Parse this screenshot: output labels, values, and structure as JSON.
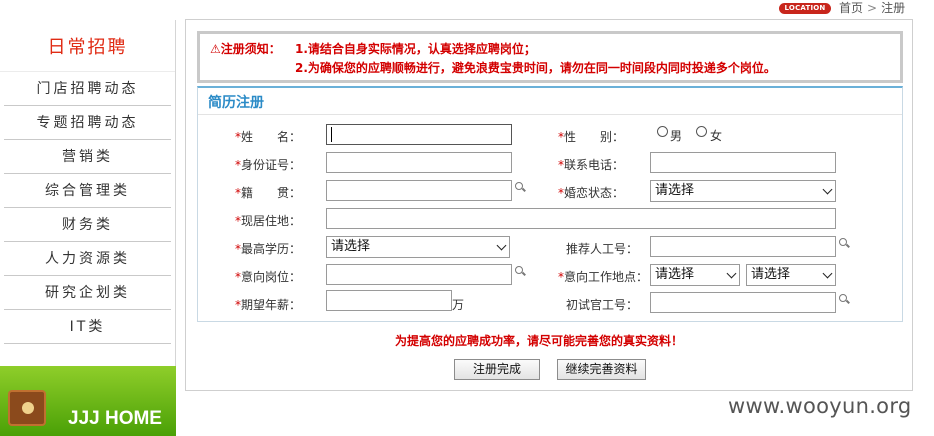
{
  "breadcrumb": {
    "location_badge": "LOCATION",
    "home": "首页",
    "separator": ">",
    "current": "注册"
  },
  "sidebar": {
    "title": "日常招聘",
    "items": [
      {
        "label": "门店招聘动态"
      },
      {
        "label": "专题招聘动态"
      },
      {
        "label": "营销类"
      },
      {
        "label": "综合管理类"
      },
      {
        "label": "财务类"
      },
      {
        "label": "人力资源类"
      },
      {
        "label": "研究企划类"
      },
      {
        "label": "IT类"
      }
    ],
    "banner_text": "JJJ HOME"
  },
  "notice": {
    "label": "注册须知：",
    "line1": "1.请结合自身实际情况，认真选择应聘岗位；",
    "line2": "2.为确保您的应聘顺畅进行，避免浪费宝贵时间，请勿在同一时间段内同时投递多个岗位。"
  },
  "form": {
    "title": "简历注册",
    "name_label": "姓　　名：",
    "gender_label": "性　　别：",
    "gender_male": "男",
    "gender_female": "女",
    "id_label": "身份证号：",
    "phone_label": "联系电话：",
    "hometown_label": "籍　　贯：",
    "marital_label": "婚恋状态：",
    "marital_value": "请选择",
    "address_label": "现居住地：",
    "education_label": "最高学历：",
    "education_value": "请选择",
    "referrer_label": "推荐人工号：",
    "position_label": "意向岗位：",
    "location_label": "意向工作地点：",
    "location_value1": "请选择",
    "location_value2": "请选择",
    "salary_label": "期望年薪：",
    "salary_unit": "万",
    "interviewer_label": "初试官工号："
  },
  "hint": "为提高您的应聘成功率，请尽可能完善您的真实资料！",
  "buttons": {
    "finish": "注册完成",
    "continue": "继续完善资料"
  },
  "watermark": "www.wooyun.org",
  "colors": {
    "accent_red": "#d30000",
    "title_blue": "#2b8bc7",
    "banner_green": "#6bb61a"
  }
}
